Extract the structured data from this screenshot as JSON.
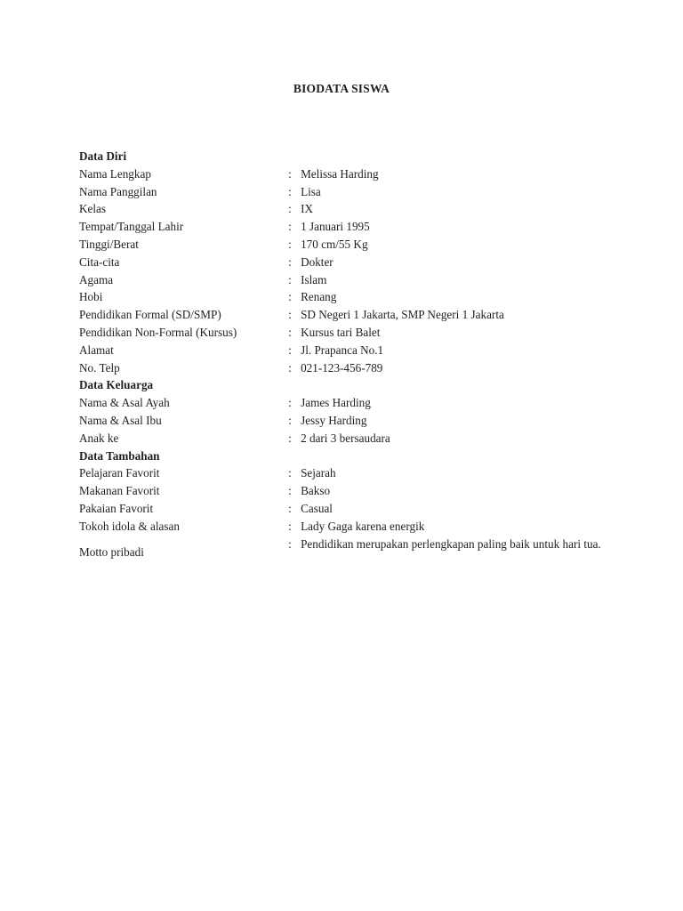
{
  "document": {
    "title": "BIODATA SISWA",
    "colon": ":"
  },
  "sections": [
    {
      "heading": "Data Diri",
      "rows": [
        {
          "label": "Nama Lengkap",
          "value": "Melissa Harding"
        },
        {
          "label": "Nama Panggilan",
          "value": "Lisa"
        },
        {
          "label": "Kelas",
          "value": "IX"
        },
        {
          "label": "Tempat/Tanggal Lahir",
          "value": "1 Januari 1995"
        },
        {
          "label": "Tinggi/Berat",
          "value": "170 cm/55 Kg"
        },
        {
          "label": "Cita-cita",
          "value": "Dokter"
        },
        {
          "label": "Agama",
          "value": "Islam"
        },
        {
          "label": "Hobi",
          "value": "Renang"
        },
        {
          "label": "Pendidikan Formal (SD/SMP)",
          "value": "SD Negeri 1 Jakarta, SMP Negeri 1 Jakarta"
        },
        {
          "label": "Pendidikan Non-Formal (Kursus)",
          "value": "Kursus tari Balet"
        },
        {
          "label": "Alamat",
          "value": "Jl. Prapanca No.1"
        },
        {
          "label": "No. Telp",
          "value": "021-123-456-789"
        }
      ]
    },
    {
      "heading": "Data Keluarga",
      "rows": [
        {
          "label": "Nama & Asal Ayah",
          "value": "James Harding"
        },
        {
          "label": "Nama & Asal Ibu",
          "value": "Jessy Harding"
        },
        {
          "label": "Anak ke",
          "value": "2 dari 3 bersaudara"
        }
      ]
    },
    {
      "heading": "Data Tambahan",
      "rows": [
        {
          "label": "Pelajaran Favorit",
          "value": "Sejarah"
        },
        {
          "label": "Makanan Favorit",
          "value": "Bakso"
        },
        {
          "label": "Pakaian Favorit",
          "value": "Casual"
        },
        {
          "label": "Tokoh idola & alasan",
          "value": "Lady Gaga karena energik"
        },
        {
          "label": "Motto pribadi",
          "value": "Pendidikan merupakan perlengkapan paling baik untuk hari tua."
        }
      ]
    }
  ]
}
